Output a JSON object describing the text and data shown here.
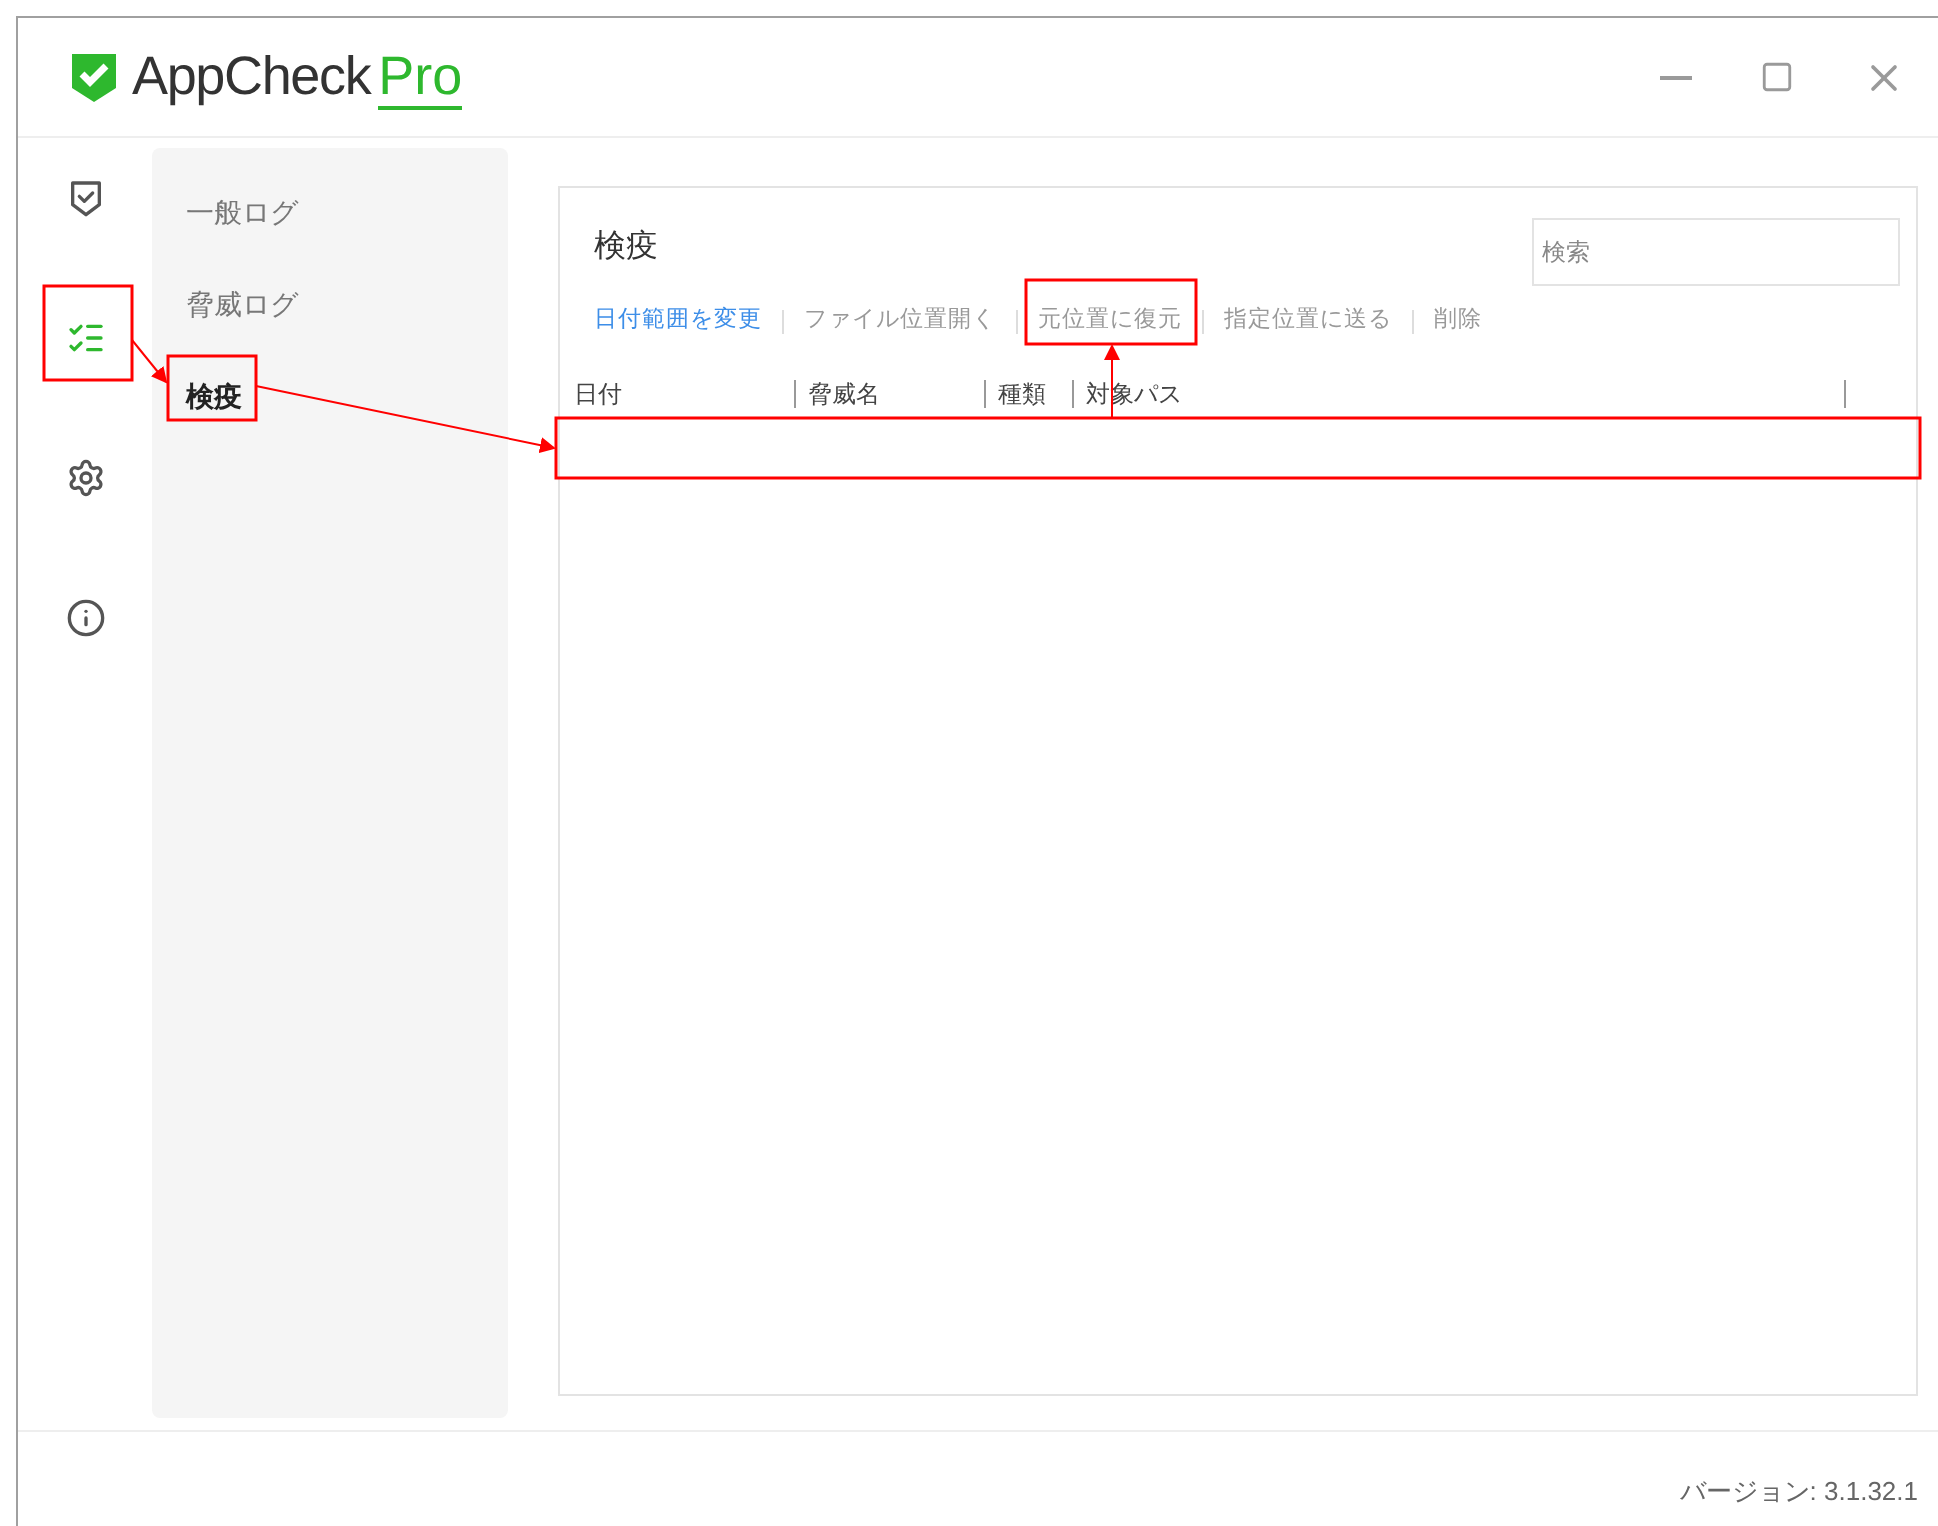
{
  "logo": {
    "name": "AppCheck",
    "suffix": "Pro"
  },
  "rail": [
    {
      "kind": "shield",
      "selected": false
    },
    {
      "kind": "checklist",
      "selected": true
    },
    {
      "kind": "settings",
      "selected": false
    },
    {
      "kind": "info",
      "selected": false
    }
  ],
  "nav": [
    {
      "label": "一般ログ",
      "selected": false
    },
    {
      "label": "脅威ログ",
      "selected": false
    },
    {
      "label": "検疫",
      "selected": true
    }
  ],
  "panel": {
    "title": "検疫",
    "search": {
      "placeholder": "検索"
    },
    "actions": [
      {
        "label": "日付範囲を変更",
        "disabled": false
      },
      {
        "label": "ファイル位置開く",
        "disabled": true
      },
      {
        "label": "元位置に復元",
        "disabled": true
      },
      {
        "label": "指定位置に送る",
        "disabled": true
      },
      {
        "label": "削除",
        "disabled": true
      }
    ],
    "columns": [
      "日付",
      "脅威名",
      "種類",
      "対象パス"
    ]
  },
  "version": "バージョン: 3.1.32.1"
}
